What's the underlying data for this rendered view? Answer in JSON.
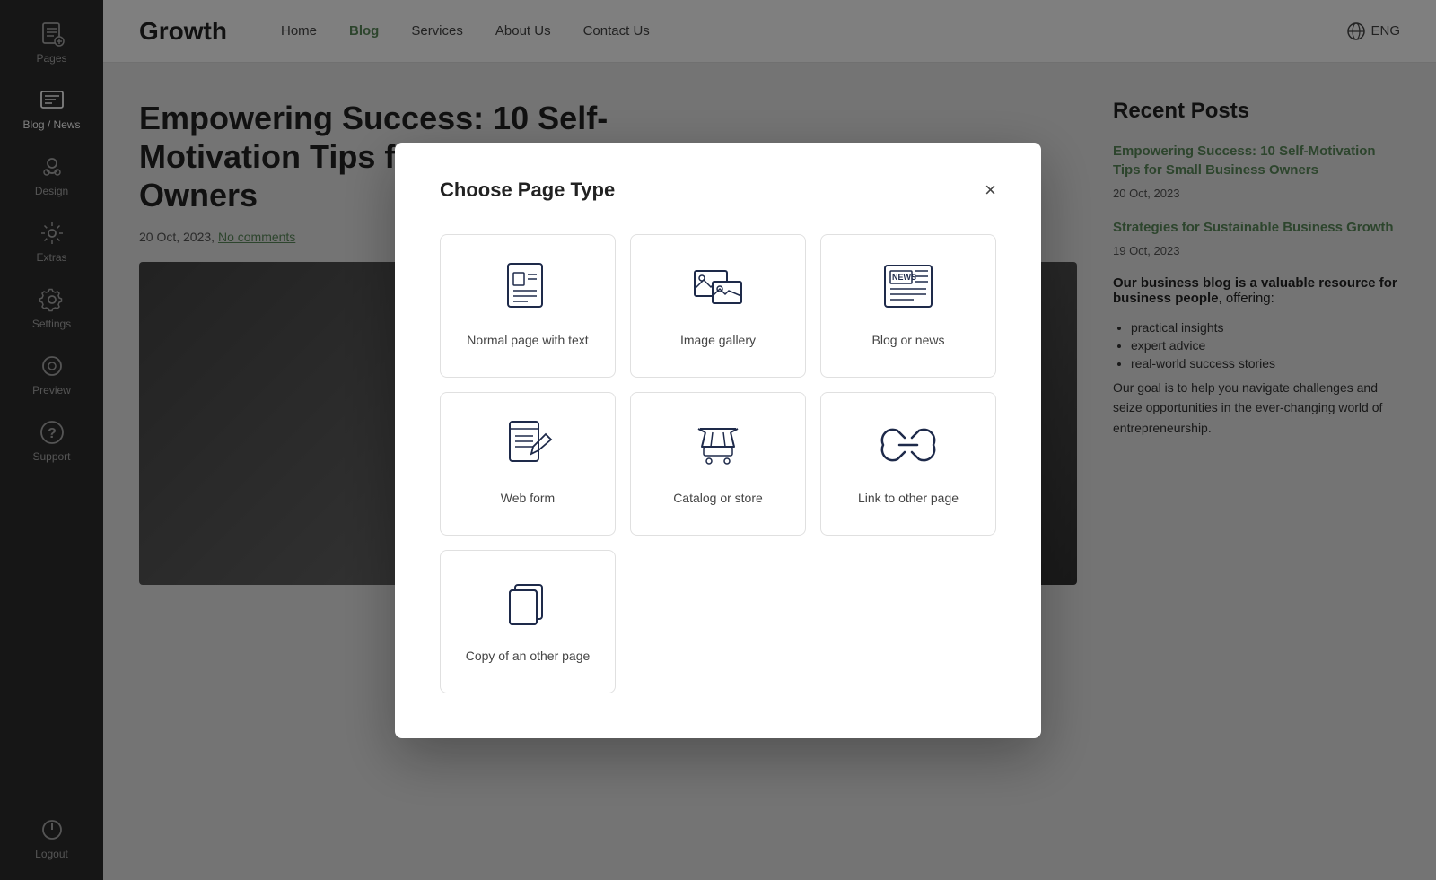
{
  "sidebar": {
    "items": [
      {
        "label": "Pages",
        "icon": "pages-icon"
      },
      {
        "label": "Blog / News",
        "icon": "blog-icon",
        "active": true
      },
      {
        "label": "Design",
        "icon": "design-icon"
      },
      {
        "label": "Extras",
        "icon": "extras-icon"
      },
      {
        "label": "Settings",
        "icon": "settings-icon"
      },
      {
        "label": "Preview",
        "icon": "preview-icon"
      },
      {
        "label": "Support",
        "icon": "support-icon"
      },
      {
        "label": "Logout",
        "icon": "logout-icon"
      }
    ]
  },
  "topbar": {
    "logo": "Growth",
    "nav": [
      {
        "label": "Home",
        "active": false
      },
      {
        "label": "Blog",
        "active": true
      },
      {
        "label": "Services",
        "active": false
      },
      {
        "label": "About Us",
        "active": false
      },
      {
        "label": "Contact Us",
        "active": false
      }
    ],
    "lang": "ENG"
  },
  "page": {
    "title": "Empowering Success: 10 Self-Motivation Tips for Small Business Owners",
    "meta_date": "20 Oct, 2023",
    "meta_comments": "No comments"
  },
  "sidebar_content": {
    "recent_title": "Recent Posts",
    "posts": [
      {
        "title": "Empowering Success: 10 Self-Motivation Tips for Small Business Owners",
        "date": "20 Oct, 2023"
      },
      {
        "title": "Strategies for Sustainable Business Growth",
        "date": "19 Oct, 2023"
      }
    ],
    "desc_bold": "Our business blog is a valuable resource for business people",
    "desc_rest": ", offering:",
    "list": [
      "practical insights",
      "expert advice",
      "real-world success stories"
    ],
    "goal": "Our goal is to help you navigate challenges and seize opportunities in the ever-changing world of entrepreneurship."
  },
  "modal": {
    "title": "Choose Page Type",
    "close_label": "×",
    "items": [
      {
        "label": "Normal page with text",
        "icon": "normal-page-icon"
      },
      {
        "label": "Image gallery",
        "icon": "image-gallery-icon"
      },
      {
        "label": "Blog or news",
        "icon": "blog-news-icon"
      },
      {
        "label": "Web form",
        "icon": "web-form-icon"
      },
      {
        "label": "Catalog or store",
        "icon": "catalog-icon"
      },
      {
        "label": "Link to other page",
        "icon": "link-icon"
      },
      {
        "label": "Copy of an other page",
        "icon": "copy-icon"
      }
    ]
  }
}
